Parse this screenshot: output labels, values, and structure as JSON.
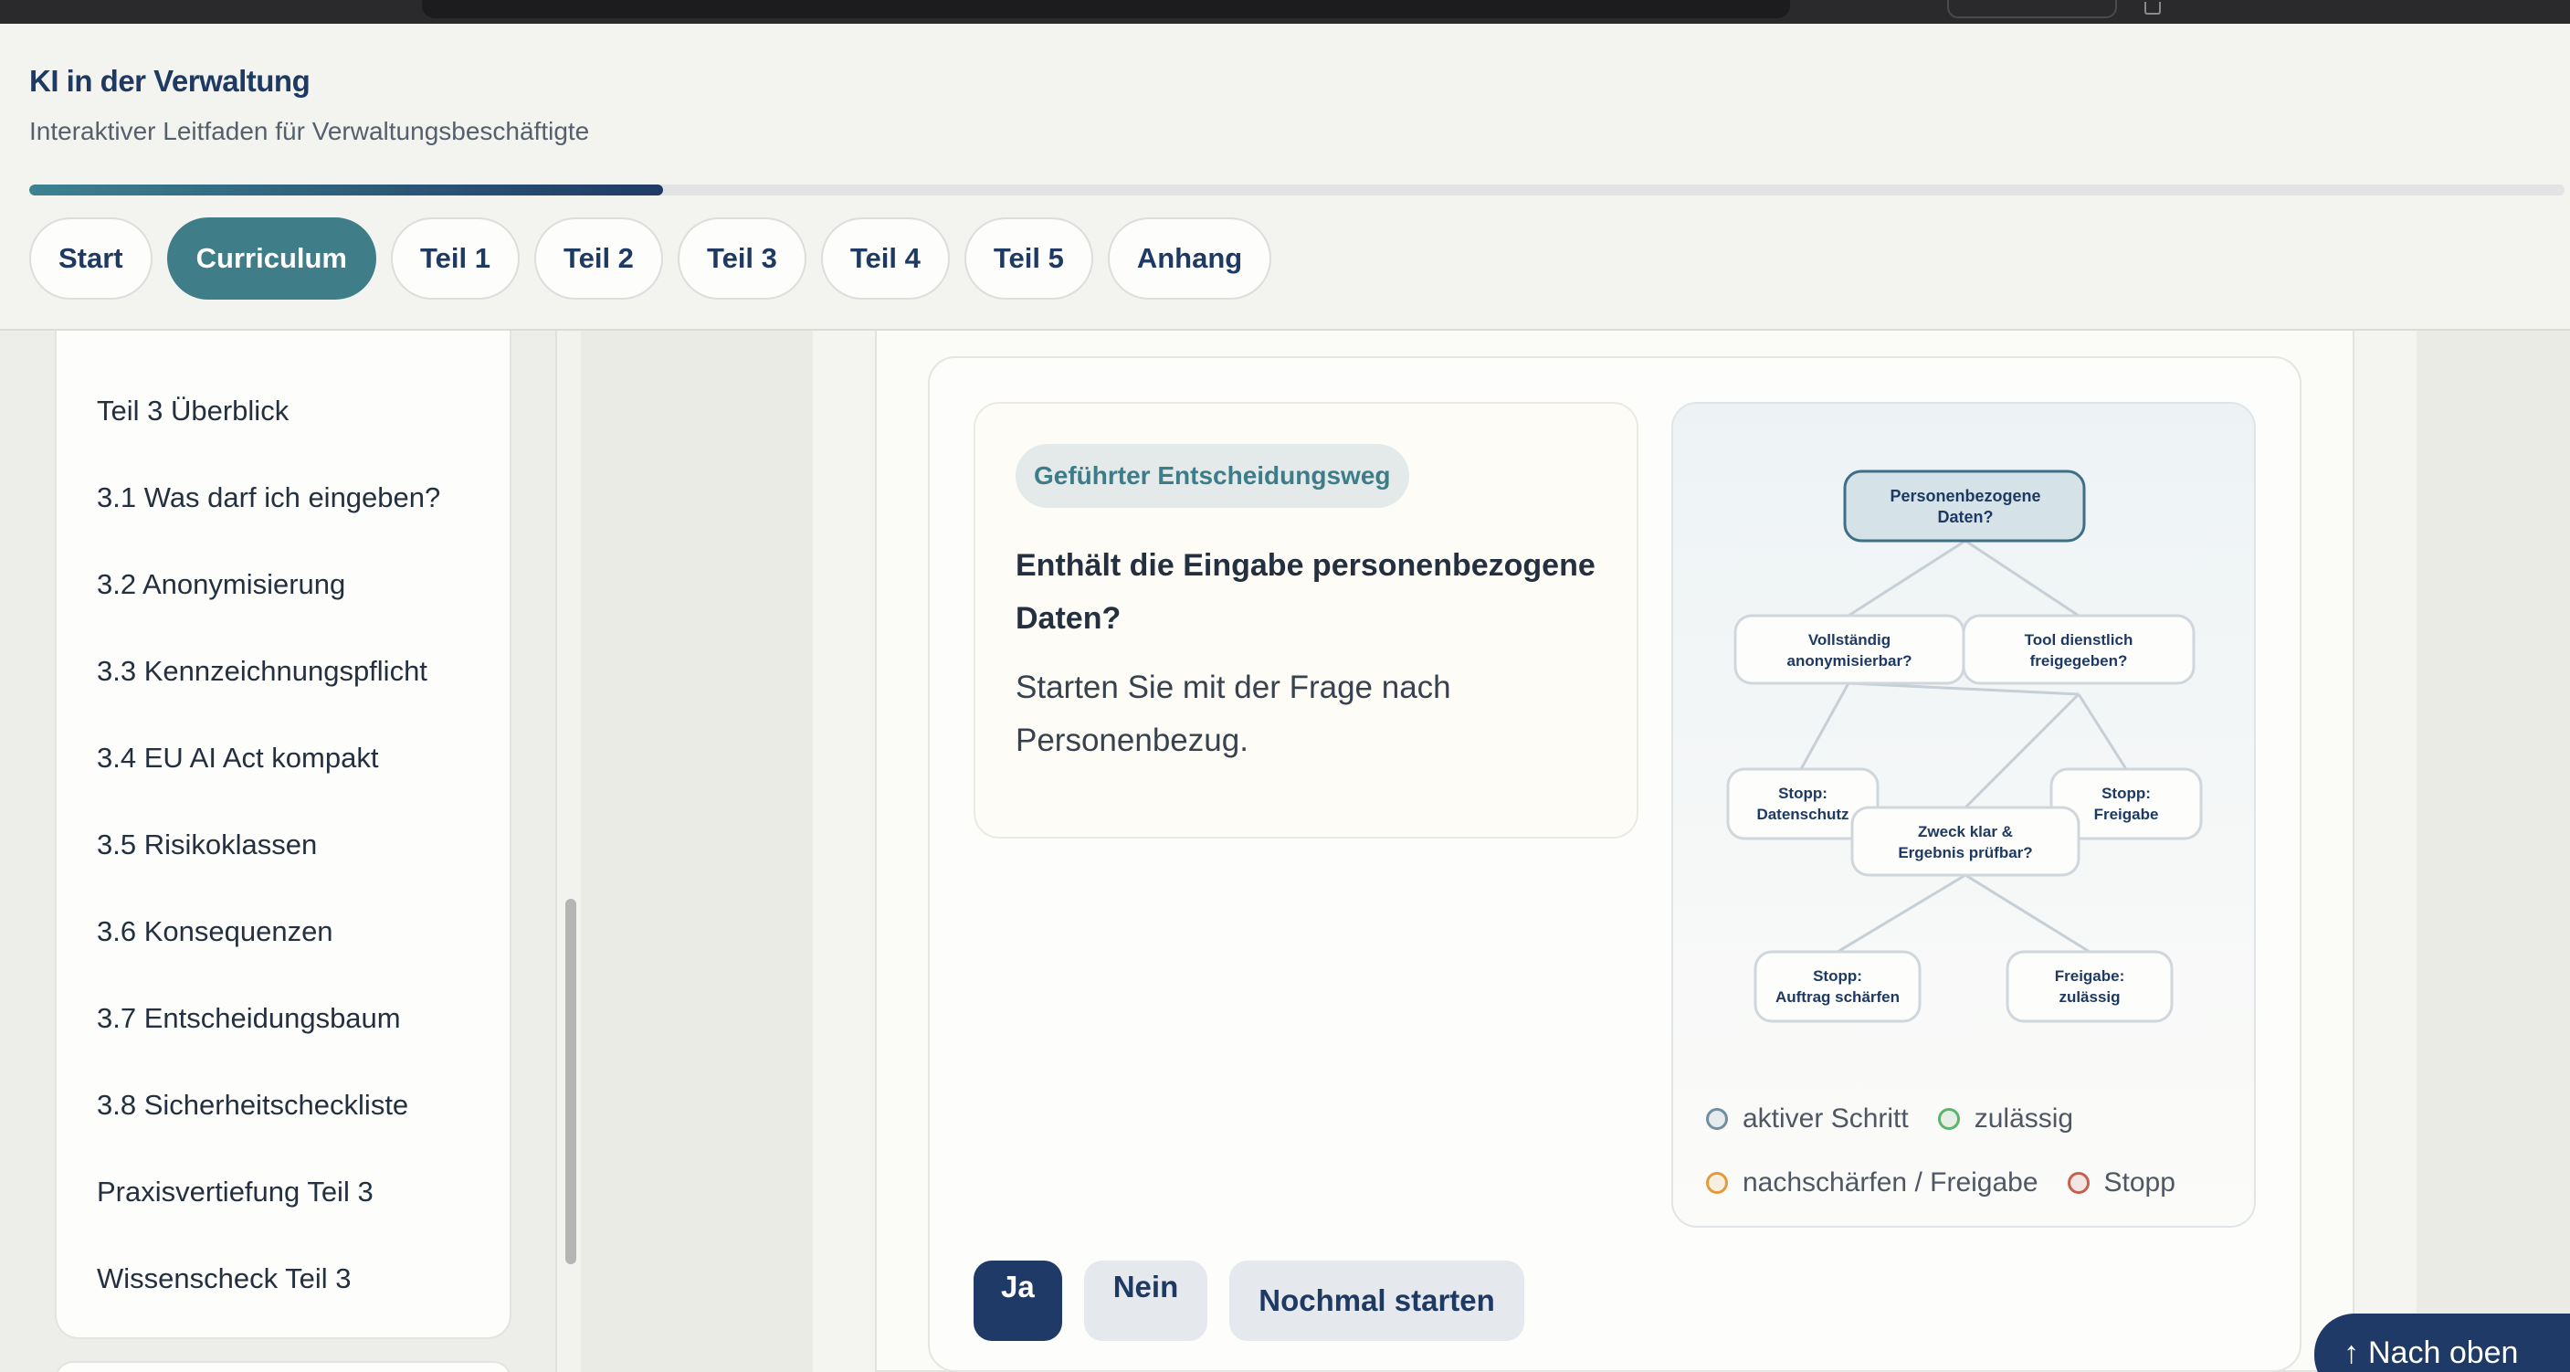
{
  "header": {
    "title": "KI in der Verwaltung",
    "subtitle": "Interaktiver Leitfaden für Verwaltungsbeschäftigte",
    "progress_fraction": 0.25,
    "tabs": [
      {
        "label": "Start",
        "active": false
      },
      {
        "label": "Curriculum",
        "active": true
      },
      {
        "label": "Teil 1",
        "active": false
      },
      {
        "label": "Teil 2",
        "active": false
      },
      {
        "label": "Teil 3",
        "active": false
      },
      {
        "label": "Teil 4",
        "active": false
      },
      {
        "label": "Teil 5",
        "active": false
      },
      {
        "label": "Anhang",
        "active": false
      }
    ]
  },
  "sidebar": {
    "items": [
      {
        "label": "Teil 3 Überblick"
      },
      {
        "label": "3.1 Was darf ich eingeben?"
      },
      {
        "label": "3.2 Anonymisierung"
      },
      {
        "label": "3.3 Kennzeichnungspflicht"
      },
      {
        "label": "3.4 EU AI Act kompakt"
      },
      {
        "label": "3.5 Risikoklassen"
      },
      {
        "label": "3.6 Konsequenzen"
      },
      {
        "label": "3.7 Entscheidungsbaum"
      },
      {
        "label": "3.8 Sicherheitscheckliste"
      },
      {
        "label": "Praxisvertiefung Teil 3"
      },
      {
        "label": "Wissenscheck Teil 3"
      }
    ]
  },
  "question": {
    "badge": "Geführter Entscheidungsweg",
    "title": "Enthält die Eingabe personenbezogene Daten?",
    "description": "Starten Sie mit der Frage nach Personenbezug."
  },
  "diagram": {
    "nodes": {
      "root": {
        "line1": "Personenbezogene",
        "line2": "Daten?",
        "state": "active"
      },
      "anon": {
        "line1": "Vollständig",
        "line2": "anonymisierbar?",
        "state": "neutral"
      },
      "tool": {
        "line1": "Tool dienstlich",
        "line2": "freigegeben?",
        "state": "neutral"
      },
      "stop_ds": {
        "line1": "Stopp:",
        "line2": "Datenschutz",
        "state": "neutral"
      },
      "stop_fg": {
        "line1": "Stopp:",
        "line2": "Freigabe",
        "state": "neutral"
      },
      "zweck": {
        "line1": "Zweck klar &",
        "line2": "Ergebnis prüfbar?",
        "state": "neutral"
      },
      "stop_auftrag": {
        "line1": "Stopp:",
        "line2": "Auftrag schärfen",
        "state": "neutral"
      },
      "freigabe": {
        "line1": "Freigabe:",
        "line2": "zulässig",
        "state": "neutral"
      }
    },
    "legend": [
      {
        "label": "aktiver Schritt",
        "color": "#6f8fa3"
      },
      {
        "label": "zulässig",
        "color": "#5cb36a"
      },
      {
        "label": "nachschärfen / Freigabe",
        "color": "#e39a3c"
      },
      {
        "label": "Stopp",
        "color": "#c4604f"
      }
    ]
  },
  "actions": {
    "yes": "Ja",
    "no": "Nein",
    "restart": "Nochmal starten"
  },
  "back_to_top": {
    "arrow": "↑",
    "label": "Nach oben"
  },
  "colors": {
    "brand_navy": "#1f3a66",
    "accent_teal": "#3f7e89",
    "active_node_fill": "#d5e3e9",
    "active_node_border": "#3d6f88"
  }
}
